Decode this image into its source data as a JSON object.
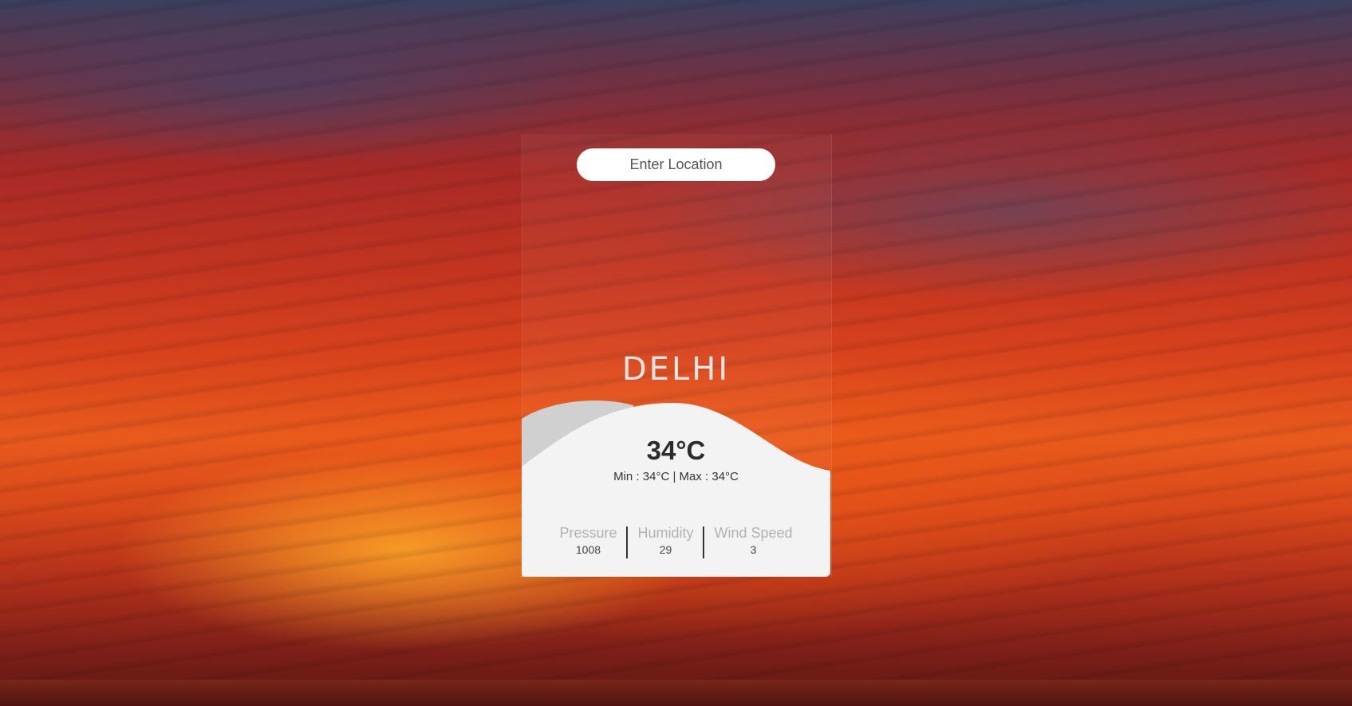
{
  "search": {
    "placeholder": "Enter Location"
  },
  "weather": {
    "city": "DELHI",
    "temperature": "34°C",
    "min_max": "Min : 34°C | Max : 34°C"
  },
  "stats": [
    {
      "label": "Pressure",
      "value": "1008"
    },
    {
      "label": "Humidity",
      "value": "29"
    },
    {
      "label": "Wind Speed",
      "value": "3"
    }
  ],
  "colors": {
    "card_background": "#f3f3f3",
    "wave_shadow": "#d0d0d0",
    "city_text": "#e6e6e6",
    "temperature_text": "#2b2b2b",
    "stat_label": "#b3b3b3"
  }
}
